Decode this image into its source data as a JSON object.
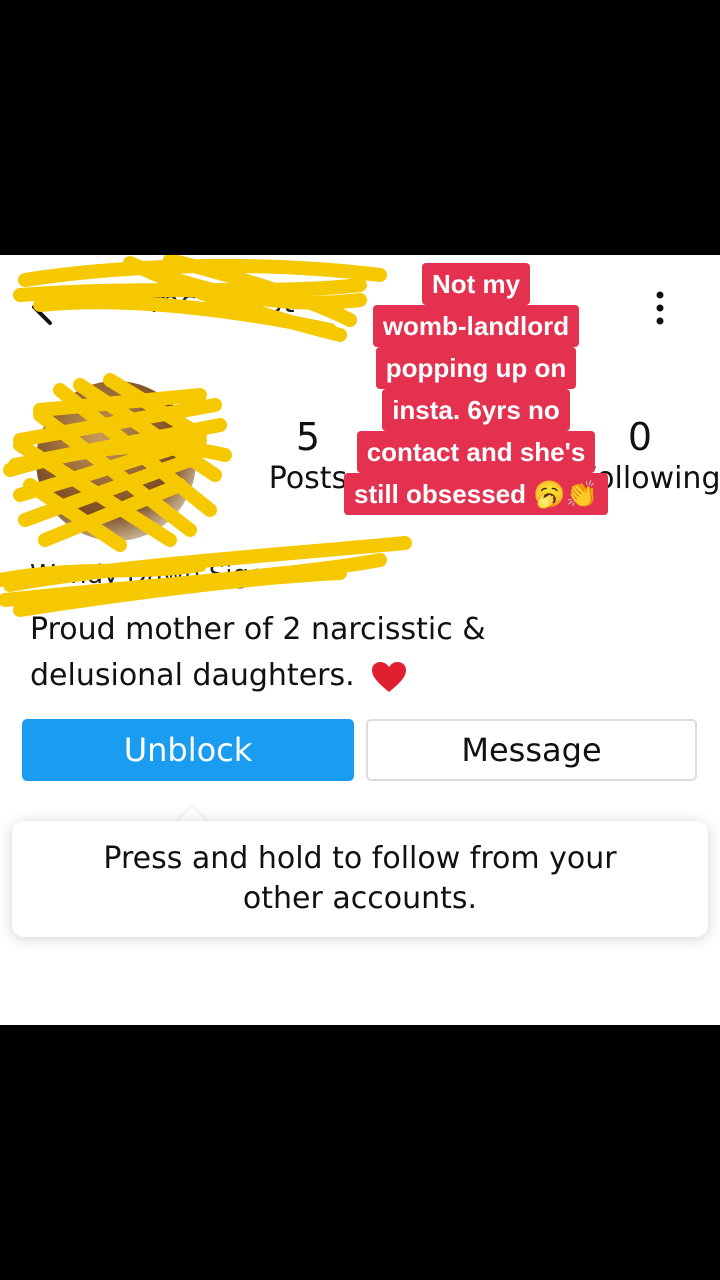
{
  "profile": {
    "username": "mc...cest",
    "bio_name": "Wendy Dawn Siger",
    "bio_text": "Proud mother of 2 narcisstic & delusional daughters."
  },
  "stats": {
    "posts": {
      "value": "5",
      "label": "Posts"
    },
    "following": {
      "value": "0",
      "label": "Following"
    }
  },
  "buttons": {
    "unblock_label": "Unblock",
    "message_label": "Message"
  },
  "tooltip": {
    "text": "Press and hold to follow from your other accounts."
  },
  "caption": {
    "lines": [
      "Not my",
      "womb-landlord",
      "popping up on",
      "insta. 6yrs no",
      "contact and she's",
      "still obsessed 🥱👏"
    ]
  },
  "icons": {
    "back": "back-arrow-icon",
    "more": "more-vertical-icon",
    "heart": "red-heart-icon"
  },
  "colors": {
    "accent": "#1a9df0",
    "caption_bg": "#e53150",
    "scribble": "#f5c800"
  }
}
